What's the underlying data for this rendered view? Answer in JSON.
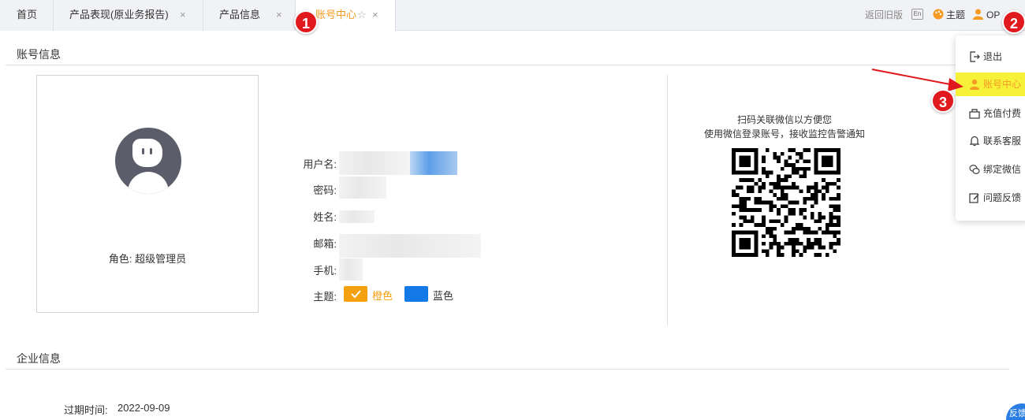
{
  "tabs": [
    {
      "label": "首页",
      "closable": false,
      "active": false
    },
    {
      "label": "产品表现(原业务报告)",
      "closable": true,
      "active": false
    },
    {
      "label": "产品信息",
      "closable": true,
      "active": false
    },
    {
      "label": "账号中心",
      "closable": true,
      "active": true
    }
  ],
  "topbar": {
    "back_old": "返回旧版",
    "lang": "En",
    "theme": "主题",
    "user": "OP"
  },
  "account": {
    "section_title": "账号信息",
    "role": "角色: 超级管理员",
    "fields": {
      "username": "用户名:",
      "password": "密码:",
      "name": "姓名:",
      "email": "邮箱:",
      "phone": "手机:",
      "theme": "主题:"
    },
    "themes": [
      {
        "label": "橙色",
        "color": "#f5a00f",
        "selected": true
      },
      {
        "label": "蓝色",
        "color": "#1379e6",
        "selected": false
      }
    ]
  },
  "wechat": {
    "line1": "扫码关联微信以方便您",
    "line2": "使用微信登录账号，接收监控告警通知"
  },
  "company": {
    "section_title": "企业信息",
    "expire_label": "过期时间:",
    "expire_value": "2022-09-09"
  },
  "menu": [
    {
      "label": "退出",
      "icon": "logout-icon",
      "highlight": false
    },
    {
      "label": "账号中心",
      "icon": "user-icon",
      "highlight": true
    },
    {
      "label": "充值付费",
      "icon": "recharge-icon",
      "highlight": false
    },
    {
      "label": "联系客服",
      "icon": "bell-icon",
      "highlight": false
    },
    {
      "label": "绑定微信",
      "icon": "wechat-icon",
      "highlight": false
    },
    {
      "label": "问题反馈",
      "icon": "edit-icon",
      "highlight": false
    }
  ],
  "annotations": [
    "1",
    "2",
    "3"
  ],
  "feedback_button": "反馈",
  "colors": {
    "accent": "#f59a23",
    "badge": "#e0191e",
    "highlight": "#f6f23a",
    "blue": "#1379e6"
  }
}
